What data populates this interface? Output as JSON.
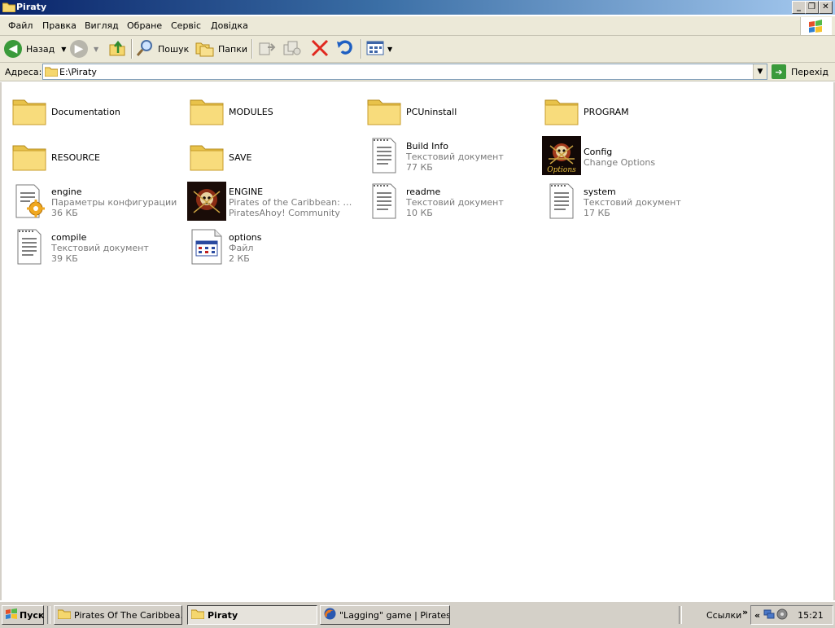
{
  "window": {
    "title": "Piraty"
  },
  "menu": [
    "Файл",
    "Правка",
    "Вигляд",
    "Обране",
    "Сервіс",
    "Довідка"
  ],
  "toolbar": {
    "back_label": "Назад",
    "search_label": "Пошук",
    "folders_label": "Папки"
  },
  "address": {
    "label": "Адреса:",
    "value": "E:\\Piraty",
    "go_label": "Перехід"
  },
  "items": [
    {
      "name": "Documentation",
      "icon": "folder-icon"
    },
    {
      "name": "MODULES",
      "icon": "folder-icon"
    },
    {
      "name": "PCUninstall",
      "icon": "folder-icon"
    },
    {
      "name": "PROGRAM",
      "icon": "folder-icon"
    },
    {
      "name": "RESOURCE",
      "icon": "folder-icon"
    },
    {
      "name": "SAVE",
      "icon": "folder-icon"
    },
    {
      "name": "Build Info",
      "type": "Текстовий документ",
      "size": "77 КБ",
      "icon": "text-document-icon"
    },
    {
      "name": "Config",
      "type": "Change Options",
      "icon": "pirate-skull-options-icon"
    },
    {
      "name": "engine",
      "type": "Параметры конфигурации",
      "size": "36 КБ",
      "icon": "config-settings-icon"
    },
    {
      "name": "ENGINE",
      "type": "Pirates of the Caribbean: New...",
      "size": "PiratesAhoy! Community",
      "icon": "pirate-skull-icon"
    },
    {
      "name": "readme",
      "type": "Текстовий документ",
      "size": "10 КБ",
      "icon": "text-document-icon"
    },
    {
      "name": "system",
      "type": "Текстовий документ",
      "size": "17 КБ",
      "icon": "text-document-icon"
    },
    {
      "name": "compile",
      "type": "Текстовий документ",
      "size": "39 КБ",
      "icon": "text-document-icon"
    },
    {
      "name": "options",
      "type": "Файл",
      "size": "2 КБ",
      "icon": "file-window-icon"
    }
  ],
  "taskbar": {
    "start_label": "Пуск",
    "tasks": [
      {
        "label": "Pirates Of The Caribbea...",
        "icon": "folder-icon"
      },
      {
        "label": "Piraty",
        "icon": "folder-icon"
      },
      {
        "label": "\"Lagging\" game | Pirates...",
        "icon": "firefox-icon"
      }
    ],
    "links_label": "Ссылки",
    "clock": "15:21"
  }
}
